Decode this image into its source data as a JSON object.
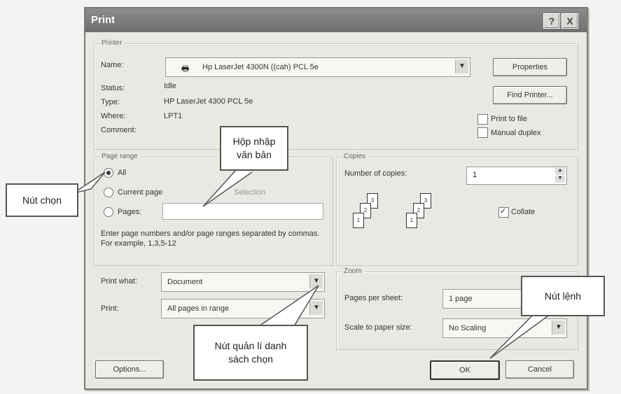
{
  "dialog": {
    "title": "Print",
    "help_btn": "?",
    "close_btn": "X"
  },
  "printer": {
    "group_label": "Printer",
    "name_label": "Name:",
    "name_value": "Hp LaserJet 4300N ((cah) PCL 5e",
    "status_label": "Status:",
    "status_value": "Idle",
    "type_label": "Type:",
    "type_value": "HP LaserJet 4300 PCL 5e",
    "where_label": "Where:",
    "where_value": "LPT1",
    "comment_label": "Comment:",
    "properties_btn": "Properties",
    "find_printer_btn": "Find Printer...",
    "print_to_file": "Print to file",
    "manual_duplex": "Manual duplex"
  },
  "page_range": {
    "group_label": "Page range",
    "all": "All",
    "current_page": "Current page",
    "selection": "Selection",
    "pages": "Pages:",
    "hint": "Enter page numbers and/or page ranges separated by commas.  For example, 1,3,5-12"
  },
  "copies": {
    "group_label": "Copies",
    "number_label": "Number of copies:",
    "number_value": "1",
    "collate": "Collate"
  },
  "print_what": {
    "label": "Print what:",
    "value": "Document",
    "print_label": "Print:",
    "print_value": "All pages in range"
  },
  "zoom": {
    "group_label": "Zoom",
    "pps_label": "Pages per sheet:",
    "pps_value": "1 page",
    "scale_label": "Scale to paper size:",
    "scale_value": "No Scaling"
  },
  "buttons": {
    "options": "Options...",
    "ok": "OK",
    "cancel": "Cancel"
  },
  "callouts": {
    "radio": "Nút chọn",
    "textbox": "Hộp nhập văn bản",
    "dropdown": "Nút quản lí danh sách chọn",
    "command": "Nút lệnh"
  }
}
